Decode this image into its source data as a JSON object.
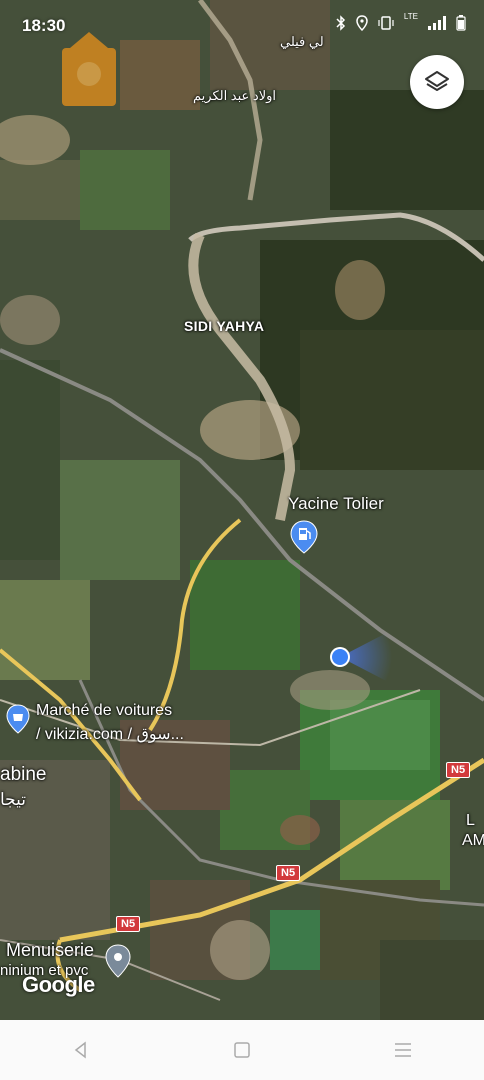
{
  "status_bar": {
    "time": "18:30",
    "network": "LTE"
  },
  "map": {
    "labels": {
      "ouled_abdelkrim": "اولاد عبد الكريم",
      "top_place": "لي فيلي",
      "sidi_yahya": "SIDI YAHYA",
      "yacine_tolier": "Yacine Tolier",
      "marche_line1": "Marché de voitures",
      "marche_line2": "/ vikizia.com / سوق...",
      "tabine_latin": "abine",
      "tabine_arabic": "تيجا",
      "menuiserie_line1": "Menuiserie",
      "menuiserie_line2": "ninium et pvc",
      "right_l": "L",
      "right_am": "AM"
    },
    "road_shields": [
      "N5",
      "N5",
      "N5"
    ],
    "attribution": "Google",
    "colors": {
      "highway": "#e8c65a",
      "road": "#c7c2b4",
      "user_dot": "#3b82f6",
      "shield": "#d2393c",
      "pin": "#4b8cf0"
    }
  },
  "icons": {
    "layers_button": "layers-icon",
    "nav_back": "back-icon",
    "nav_home": "home-icon",
    "nav_recents": "menu-icon"
  }
}
